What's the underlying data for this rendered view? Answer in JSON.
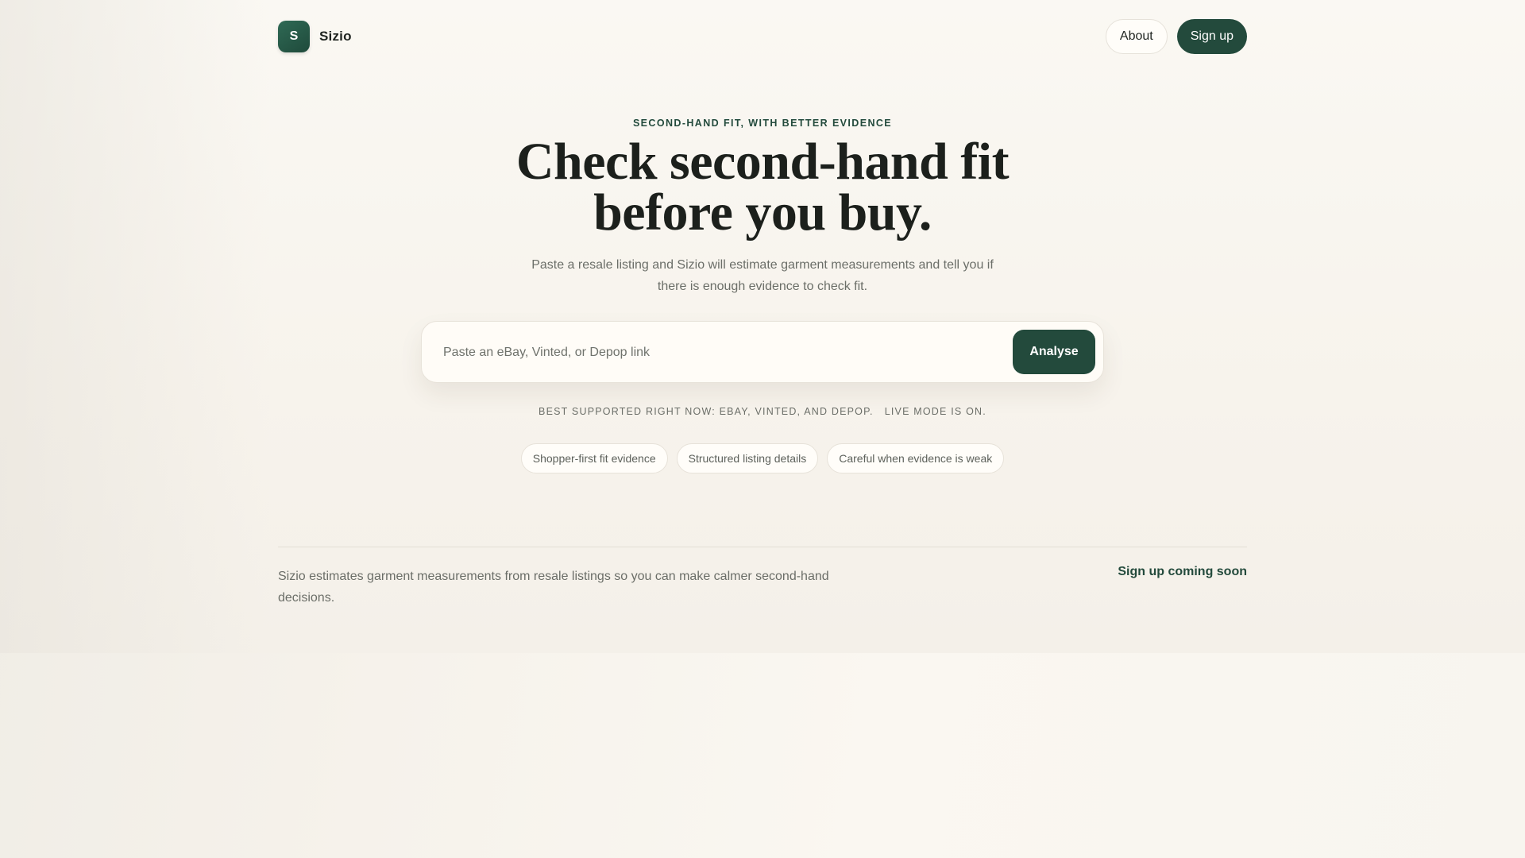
{
  "brand": {
    "logo_letter": "S",
    "name": "Sizio"
  },
  "nav": {
    "about_label": "About",
    "signup_label": "Sign up"
  },
  "hero": {
    "eyebrow": "SECOND-HAND FIT, WITH BETTER EVIDENCE",
    "headline_line1": "Check second-hand fit",
    "headline_line2": "before you buy.",
    "subtext": "Paste a resale listing and Sizio will estimate garment measurements and tell you if there is enough evidence to check fit."
  },
  "search": {
    "placeholder": "Paste an eBay, Vinted, or Depop link",
    "value": "",
    "button_label": "Analyse"
  },
  "support": {
    "platforms": "BEST SUPPORTED RIGHT NOW: EBAY, VINTED, AND DEPOP.",
    "mode": "LIVE MODE IS ON."
  },
  "pills": [
    "Shopper-first fit evidence",
    "Structured listing details",
    "Careful when evidence is weak"
  ],
  "footer": {
    "text": "Sizio estimates garment measurements from resale listings so you can make calmer second-hand decisions.",
    "signup_note": "Sign up coming soon"
  },
  "colors": {
    "accent": "#234a3c",
    "background": "#f7f4ee"
  }
}
